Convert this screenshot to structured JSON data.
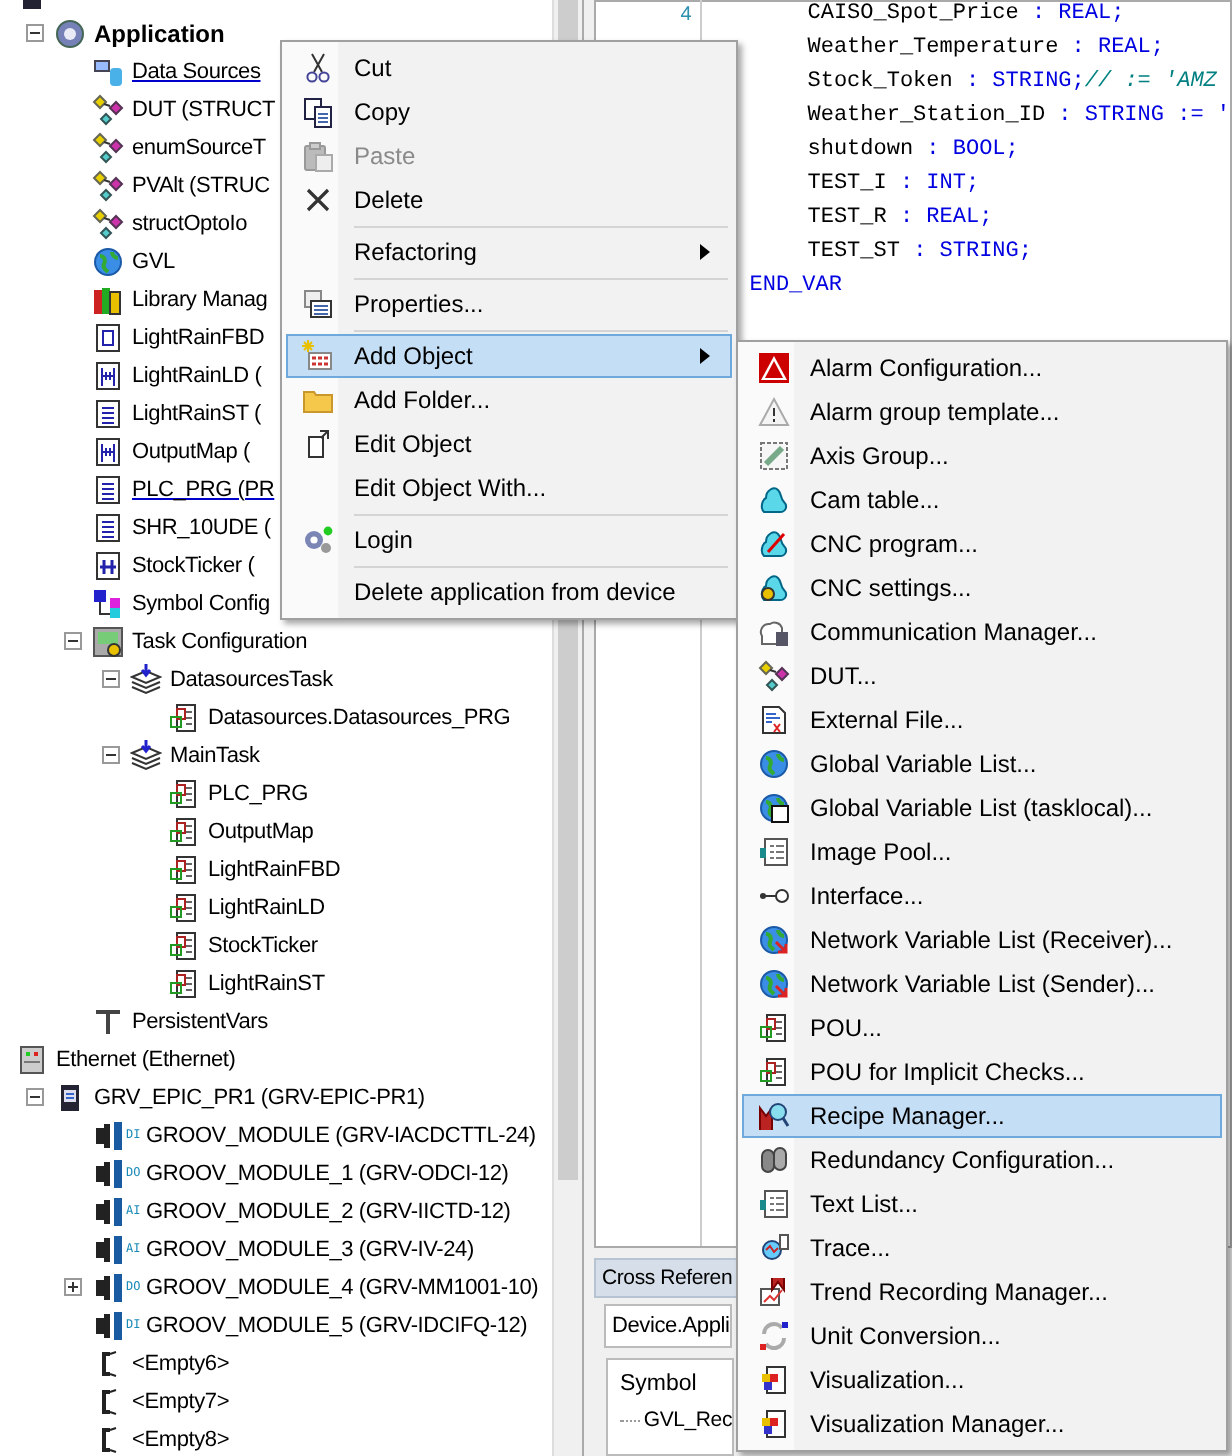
{
  "tree": [
    {
      "kind": "plc",
      "children": [
        {
          "kind": "application",
          "label": "Application",
          "expanded": true,
          "active": true,
          "underlined": false,
          "children": [
            {
              "kind": "datasources",
              "label": "Data Sources",
              "active": false,
              "underlined": true
            },
            {
              "kind": "dut",
              "label": "DUT (STRUCT",
              "active": false,
              "underlined": false
            },
            {
              "kind": "dut",
              "label": "enumSourceT",
              "active": false,
              "underlined": false
            },
            {
              "kind": "dut",
              "label": "PVAlt (STRUC",
              "active": false,
              "underlined": false
            },
            {
              "kind": "dut",
              "label": "structOptoIo",
              "active": false,
              "underlined": false
            },
            {
              "kind": "gvl",
              "label": "GVL",
              "active": false,
              "underlined": false
            },
            {
              "kind": "library",
              "label": "Library Manag",
              "active": false,
              "underlined": false
            },
            {
              "kind": "fbd",
              "label": "LightRainFBD",
              "active": false,
              "underlined": false
            },
            {
              "kind": "ld",
              "label": "LightRainLD (",
              "active": false,
              "underlined": false
            },
            {
              "kind": "st",
              "label": "LightRainST (",
              "active": false,
              "underlined": false
            },
            {
              "kind": "ld",
              "label": "OutputMap (",
              "active": false,
              "underlined": false
            },
            {
              "kind": "st",
              "label": "PLC_PRG (PR",
              "active": false,
              "underlined": true
            },
            {
              "kind": "st",
              "label": "SHR_10UDE (",
              "active": false,
              "underlined": false
            },
            {
              "kind": "cfc",
              "label": "StockTicker (",
              "active": false,
              "underlined": false
            },
            {
              "kind": "symbol",
              "label": "Symbol Config",
              "active": false,
              "underlined": false
            },
            {
              "kind": "taskconfig",
              "label": "Task Configuration",
              "expanded": true,
              "active": false,
              "underlined": false,
              "children": [
                {
                  "kind": "task",
                  "label": "DatasourcesTask",
                  "expanded": true,
                  "active": false,
                  "underlined": false,
                  "children": [
                    {
                      "kind": "call",
                      "label": "Datasources.Datasources_PRG",
                      "active": false,
                      "underlined": false
                    }
                  ]
                },
                {
                  "kind": "task",
                  "label": "MainTask",
                  "expanded": true,
                  "active": false,
                  "underlined": false,
                  "children": [
                    {
                      "kind": "call",
                      "label": "PLC_PRG",
                      "active": false,
                      "underlined": false
                    },
                    {
                      "kind": "call",
                      "label": "OutputMap",
                      "active": false,
                      "underlined": false
                    },
                    {
                      "kind": "call",
                      "label": "LightRainFBD",
                      "active": false,
                      "underlined": false
                    },
                    {
                      "kind": "call",
                      "label": "LightRainLD",
                      "active": false,
                      "underlined": false
                    },
                    {
                      "kind": "call",
                      "label": "StockTicker",
                      "active": false,
                      "underlined": false
                    },
                    {
                      "kind": "call",
                      "label": "LightRainST",
                      "active": false,
                      "underlined": false
                    }
                  ]
                }
              ]
            },
            {
              "kind": "persistent",
              "label": "PersistentVars",
              "active": false,
              "underlined": false
            }
          ]
        }
      ]
    },
    {
      "kind": "ethernet",
      "label": "Ethernet (Ethernet)",
      "children": [
        {
          "kind": "device",
          "label": "GRV_EPIC_PR1 (GRV-EPIC-PR1)",
          "expanded": true,
          "active": false,
          "underlined": false,
          "children": [
            {
              "kind": "module",
              "io": "DI",
              "label": "GROOV_MODULE (GRV-IACDCTTL-24)",
              "active": false,
              "underlined": false
            },
            {
              "kind": "module",
              "io": "DO",
              "label": "GROOV_MODULE_1 (GRV-ODCI-12)",
              "active": false,
              "underlined": false
            },
            {
              "kind": "module",
              "io": "AI",
              "label": "GROOV_MODULE_2 (GRV-IICTD-12)",
              "active": false,
              "underlined": false
            },
            {
              "kind": "module",
              "io": "AI",
              "label": "GROOV_MODULE_3 (GRV-IV-24)",
              "active": false,
              "underlined": false
            },
            {
              "kind": "module",
              "io": "DO",
              "label": "GROOV_MODULE_4 (GRV-MM1001-10)",
              "expanded": false,
              "active": false,
              "underlined": false
            },
            {
              "kind": "module",
              "io": "DI",
              "label": "GROOV_MODULE_5 (GRV-IDCIFQ-12)",
              "active": false,
              "underlined": false
            },
            {
              "kind": "empty",
              "label": "<Empty6>",
              "active": false,
              "underlined": false
            },
            {
              "kind": "empty",
              "label": "<Empty7>",
              "active": false,
              "underlined": false
            },
            {
              "kind": "empty",
              "label": "<Empty8>",
              "active": false,
              "underlined": false
            }
          ]
        }
      ]
    }
  ],
  "editor": {
    "lines": [
      {
        "number": "4",
        "indented": true,
        "segments": [
          {
            "kind": "plain",
            "text": "CAISO_Spot_Price"
          },
          {
            "kind": "keyword",
            "text": " : REAL;"
          }
        ]
      },
      {
        "indented": true,
        "segments": [
          {
            "kind": "plain",
            "text": "Weather_Temperature"
          },
          {
            "kind": "keyword",
            "text": " : REAL;"
          }
        ]
      },
      {
        "indented": true,
        "segments": [
          {
            "kind": "plain",
            "text": "Stock_Token"
          },
          {
            "kind": "keyword",
            "text": " : STRING;"
          },
          {
            "kind": "comment",
            "text": "// := 'AMZ"
          }
        ]
      },
      {
        "indented": true,
        "segments": [
          {
            "kind": "plain",
            "text": "Weather_Station_ID"
          },
          {
            "kind": "keyword",
            "text": " : STRING := '"
          }
        ]
      },
      {
        "indented": true,
        "segments": [
          {
            "kind": "plain",
            "text": "shutdown"
          },
          {
            "kind": "keyword",
            "text": " : BOOL;"
          }
        ]
      },
      {
        "indented": true,
        "segments": [
          {
            "kind": "plain",
            "text": "TEST_I"
          },
          {
            "kind": "keyword",
            "text": " : INT;"
          }
        ]
      },
      {
        "indented": true,
        "segments": [
          {
            "kind": "plain",
            "text": "TEST_R"
          },
          {
            "kind": "keyword",
            "text": " : REAL;"
          }
        ]
      },
      {
        "indented": true,
        "segments": [
          {
            "kind": "plain",
            "text": "TEST_ST"
          },
          {
            "kind": "keyword",
            "text": " : STRING;"
          }
        ]
      },
      {
        "indented": false,
        "segments": [
          {
            "kind": "keyword",
            "text": "END_VAR"
          }
        ]
      }
    ]
  },
  "cross_reference": {
    "tab": "Cross Referen",
    "scope": "Device.Appli",
    "column": "Symbol",
    "row": "GVL_Rec"
  },
  "context_menu": {
    "items": [
      {
        "kind": "item",
        "label": "Cut",
        "disabled": false,
        "selected": false,
        "submenu": false
      },
      {
        "kind": "item",
        "label": "Copy",
        "disabled": false,
        "selected": false,
        "submenu": false
      },
      {
        "kind": "item",
        "label": "Paste",
        "disabled": true,
        "selected": false,
        "submenu": false
      },
      {
        "kind": "item",
        "label": "Delete",
        "disabled": false,
        "selected": false,
        "submenu": false
      },
      {
        "kind": "separator"
      },
      {
        "kind": "item",
        "label": "Refactoring",
        "disabled": false,
        "selected": false,
        "submenu": true
      },
      {
        "kind": "separator"
      },
      {
        "kind": "item",
        "label": "Properties...",
        "disabled": false,
        "selected": false,
        "submenu": false
      },
      {
        "kind": "separator"
      },
      {
        "kind": "item",
        "label": "Add Object",
        "disabled": false,
        "selected": true,
        "submenu": true
      },
      {
        "kind": "item",
        "label": "Add Folder...",
        "disabled": false,
        "selected": false,
        "submenu": false
      },
      {
        "kind": "item",
        "label": "Edit Object",
        "disabled": false,
        "selected": false,
        "submenu": false
      },
      {
        "kind": "item",
        "label": "Edit Object With...",
        "disabled": false,
        "selected": false,
        "submenu": false
      },
      {
        "kind": "separator"
      },
      {
        "kind": "item",
        "label": "Login",
        "disabled": false,
        "selected": false,
        "submenu": false
      },
      {
        "kind": "separator"
      },
      {
        "kind": "item",
        "label": "Delete application from device",
        "disabled": false,
        "selected": false,
        "submenu": false
      }
    ]
  },
  "submenu": {
    "items": [
      {
        "label": "Alarm Configuration...",
        "selected": false
      },
      {
        "label": "Alarm group template...",
        "selected": false
      },
      {
        "label": "Axis Group...",
        "selected": false
      },
      {
        "label": "Cam table...",
        "selected": false
      },
      {
        "label": "CNC program...",
        "selected": false
      },
      {
        "label": "CNC settings...",
        "selected": false
      },
      {
        "label": "Communication Manager...",
        "selected": false
      },
      {
        "label": "DUT...",
        "selected": false
      },
      {
        "label": "External File...",
        "selected": false
      },
      {
        "label": "Global Variable List...",
        "selected": false
      },
      {
        "label": "Global Variable List (tasklocal)...",
        "selected": false
      },
      {
        "label": "Image Pool...",
        "selected": false
      },
      {
        "label": "Interface...",
        "selected": false
      },
      {
        "label": "Network Variable List (Receiver)...",
        "selected": false
      },
      {
        "label": "Network Variable List (Sender)...",
        "selected": false
      },
      {
        "label": "POU...",
        "selected": false
      },
      {
        "label": "POU for Implicit Checks...",
        "selected": false
      },
      {
        "label": "Recipe Manager...",
        "selected": true
      },
      {
        "label": "Redundancy Configuration...",
        "selected": false
      },
      {
        "label": "Text List...",
        "selected": false
      },
      {
        "label": "Trace...",
        "selected": false
      },
      {
        "label": "Trend Recording Manager...",
        "selected": false
      },
      {
        "label": "Unit Conversion...",
        "selected": false
      },
      {
        "label": "Visualization...",
        "selected": false
      },
      {
        "label": "Visualization Manager...",
        "selected": false
      }
    ]
  }
}
